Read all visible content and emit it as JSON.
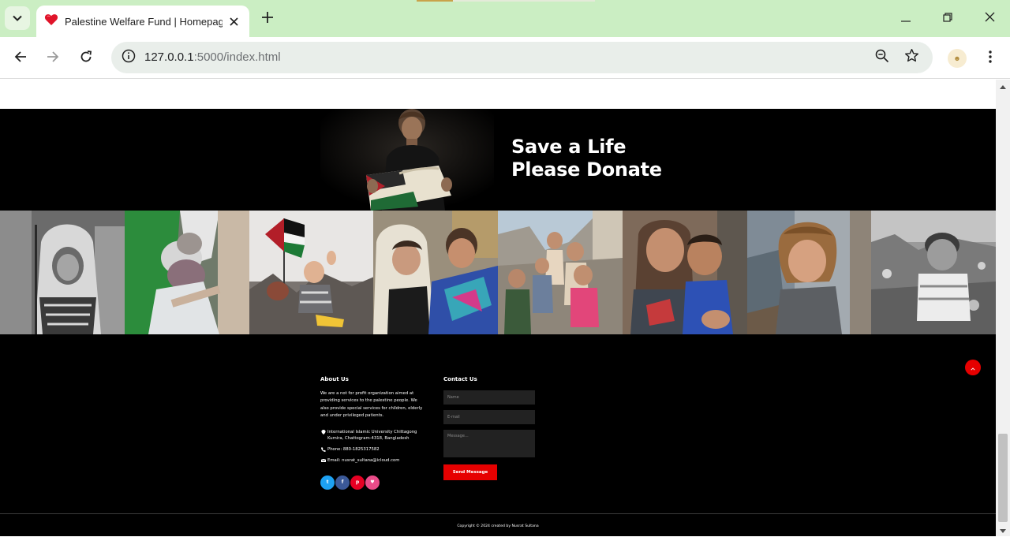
{
  "browser": {
    "tab_title": "Palestine Welfare Fund | Homepage",
    "url_host": "127.0.0.1",
    "url_path": ":5000/index.html"
  },
  "hero": {
    "title_line1": "Save a Life",
    "title_line2": "Please Donate"
  },
  "gallery": {
    "items": [
      {
        "label": "child-in-keffiyeh-bw"
      },
      {
        "label": "rescuer-holding-child"
      },
      {
        "label": "baby-with-flag-rubble"
      },
      {
        "label": "children-with-blankets"
      },
      {
        "label": "children-in-ruins"
      },
      {
        "label": "crying-children"
      },
      {
        "label": "boy-in-destroyed-street"
      },
      {
        "label": "boy-on-rubble-bw"
      }
    ]
  },
  "footer": {
    "about": {
      "title": "About Us",
      "text": "We are a not for profit organization aimed at providing services to the palestine people. We also provide special services for children, elderly and under privileged patients.",
      "address": "International Islamic University Chittagong Kumira, Chattogram-4318, Bangladesh",
      "phone": "Phone: 880-1825317582",
      "email": "Email: nusrat_sultana@icloud.com"
    },
    "socials": [
      {
        "name": "twitter",
        "glyph": "t",
        "color": "#1da1f2"
      },
      {
        "name": "facebook",
        "glyph": "f",
        "color": "#3b5998"
      },
      {
        "name": "pinterest",
        "glyph": "p",
        "color": "#e60023"
      },
      {
        "name": "dribbble",
        "glyph": "♥",
        "color": "#ea4c89"
      }
    ],
    "contact": {
      "title": "Contact Us",
      "name_placeholder": "Name",
      "email_placeholder": "E-mail",
      "message_placeholder": "Message...",
      "send_label": "Send Message"
    },
    "copyright": "Copyright © 2024 created by Nusrat Sultana"
  },
  "colors": {
    "accent": "#e60000",
    "tabbar": "#cbeec3"
  }
}
